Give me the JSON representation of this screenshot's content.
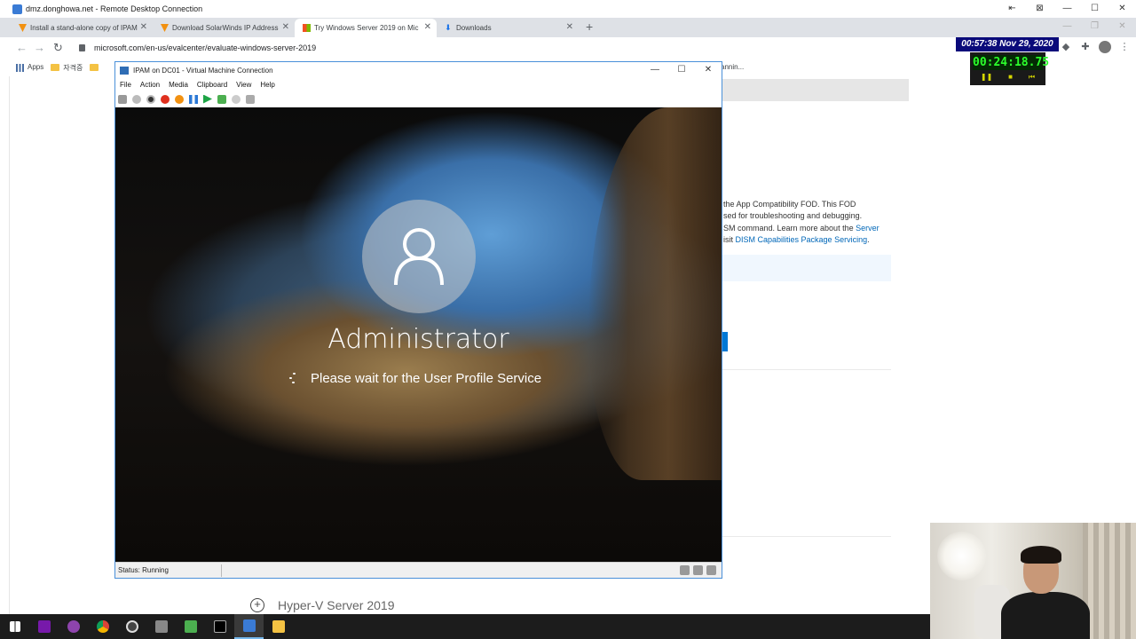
{
  "rdp": {
    "title": "dmz.donghowa.net - Remote Desktop Connection"
  },
  "browser": {
    "tabs": [
      {
        "label": "Install a stand-alone copy of IPAM",
        "icon": "solarwinds-icon",
        "active": false
      },
      {
        "label": "Download SolarWinds IP Address",
        "icon": "solarwinds-icon",
        "active": false
      },
      {
        "label": "Try Windows Server 2019 on Mic",
        "icon": "microsoft-icon",
        "active": true
      },
      {
        "label": "Downloads",
        "icon": "download-icon",
        "active": false
      }
    ],
    "url": "microsoft.com/en-us/evalcenter/evaluate-windows-server-2019",
    "bookmarks": {
      "apps": "Apps",
      "folder": "자격증"
    },
    "overflow_text": "annin..."
  },
  "page": {
    "lines": [
      "the App Compatibility FOD. This FOD",
      "sed for troubleshooting and debugging.",
      "SM command. Learn more about the"
    ],
    "link1": "Server",
    "line4_prefix": "isit",
    "link2": "DISM Capabilities Package Servicing",
    "line4_suffix": ".",
    "hyperv_item": "Hyper-V Server 2019"
  },
  "overlay": {
    "clock": "00:57:38  Nov 29, 2020",
    "stopwatch": "00:24:18.75"
  },
  "vm": {
    "title": "IPAM on DC01 - Virtual Machine Connection",
    "menu": [
      "File",
      "Action",
      "Media",
      "Clipboard",
      "View",
      "Help"
    ],
    "username": "Administrator",
    "message": "Please wait for the User Profile Service",
    "status": "Status: Running"
  },
  "colors": {
    "accent": "#0078d4",
    "link": "#0067b8",
    "vm_border": "#4a90d9",
    "clock_bg": "#0a0a7a",
    "stopwatch_digits": "#2cff2c"
  }
}
